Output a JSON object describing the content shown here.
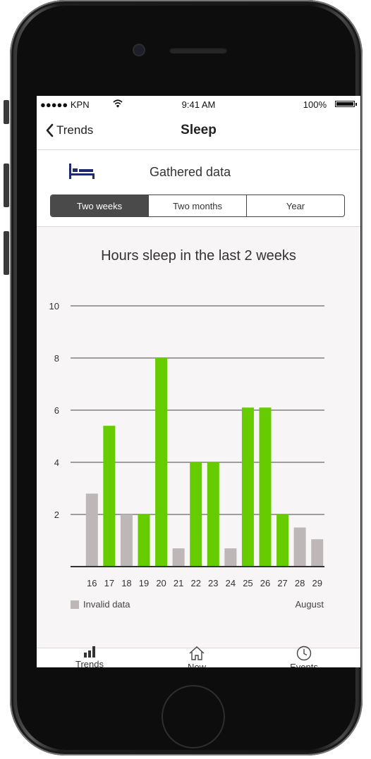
{
  "status_bar": {
    "carrier": "●●●●● KPN",
    "time": "9:41 AM",
    "battery": "100%"
  },
  "navbar": {
    "back_label": "Trends",
    "title": "Sleep"
  },
  "header": {
    "title": "Gathered data",
    "icon": "bed-icon"
  },
  "segments": [
    {
      "label": "Two weeks",
      "active": true
    },
    {
      "label": "Two months",
      "active": false
    },
    {
      "label": "Year",
      "active": false
    }
  ],
  "legend": {
    "invalid_label": "Invalid data",
    "month_label": "August"
  },
  "colors": {
    "valid": "#66cc00",
    "invalid": "#bdb7b8",
    "segment_active": "#4a4a4a"
  },
  "chart_data": {
    "type": "bar",
    "title": "Hours sleep in the last 2 weeks",
    "categories": [
      "16",
      "17",
      "18",
      "19",
      "20",
      "21",
      "22",
      "23",
      "24",
      "25",
      "26",
      "27",
      "28",
      "29"
    ],
    "values": [
      2.8,
      5.4,
      2.0,
      2.0,
      8.0,
      0.7,
      4.0,
      4.0,
      0.7,
      6.1,
      6.1,
      2.0,
      1.5,
      1.05
    ],
    "valid": [
      false,
      true,
      false,
      true,
      true,
      false,
      true,
      true,
      false,
      true,
      true,
      true,
      false,
      false
    ],
    "ylim": [
      0,
      10
    ],
    "yticks": [
      2,
      4,
      6,
      8,
      10
    ],
    "grid": true,
    "xlabel": "",
    "ylabel": ""
  },
  "tabbar": [
    {
      "label": "Trends",
      "icon": "bar-chart-icon"
    },
    {
      "label": "Now",
      "icon": "home-icon"
    },
    {
      "label": "Events",
      "icon": "clock-icon"
    }
  ]
}
